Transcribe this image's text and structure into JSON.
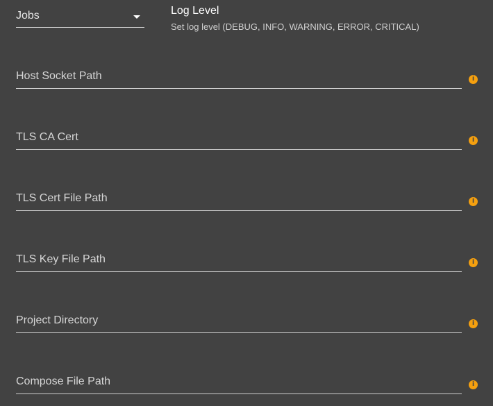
{
  "log_level": {
    "selected_value": "Jobs",
    "heading": "Log Level",
    "description": "Set log level (DEBUG, INFO, WARNING, ERROR, CRITICAL)"
  },
  "fields": {
    "host_socket_path": {
      "label": "Host Socket Path"
    },
    "tls_ca_cert": {
      "label": "TLS CA Cert"
    },
    "tls_cert_file_path": {
      "label": "TLS Cert File Path"
    },
    "tls_key_file_path": {
      "label": "TLS Key File Path"
    },
    "project_directory": {
      "label": "Project Directory"
    },
    "compose_file_path": {
      "label": "Compose File Path"
    }
  },
  "icons": {
    "info": "info-icon"
  },
  "colors": {
    "background": "#424242",
    "info_accent": "#f5a00f",
    "text_primary": "#ffffff",
    "text_secondary": "#cfcfcf"
  }
}
